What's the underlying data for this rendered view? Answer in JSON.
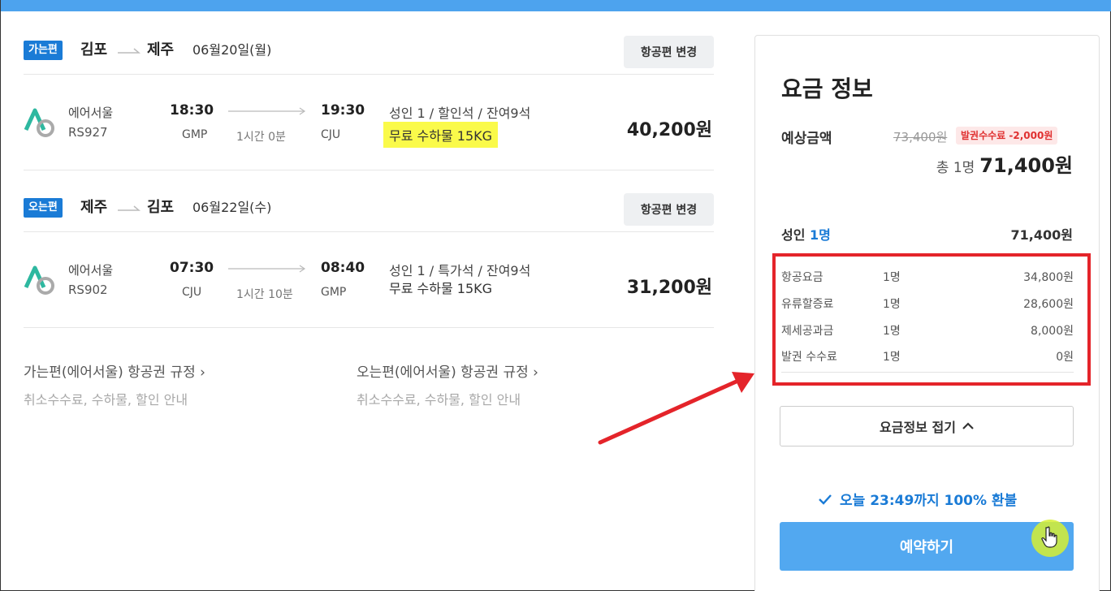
{
  "outbound": {
    "badge": "가는편",
    "from": "김포",
    "to": "제주",
    "date": "06월20일(월)",
    "change_label": "항공편 변경",
    "airline": "에어서울",
    "flight_no": "RS927",
    "dep_time": "18:30",
    "dep_airport": "GMP",
    "duration": "1시간 0분",
    "arr_time": "19:30",
    "arr_airport": "CJU",
    "fare": "성인 1 / 할인석 / 잔여9석",
    "baggage": "무료 수하물 15KG",
    "price": "40,200원"
  },
  "inbound": {
    "badge": "오는편",
    "from": "제주",
    "to": "김포",
    "date": "06월22일(수)",
    "change_label": "항공편 변경",
    "airline": "에어서울",
    "flight_no": "RS902",
    "dep_time": "07:30",
    "dep_airport": "CJU",
    "duration": "1시간 10분",
    "arr_time": "08:40",
    "arr_airport": "GMP",
    "fare": "성인 1 / 특가석 / 잔여9석",
    "baggage": "무료 수하물 15KG",
    "price": "31,200원"
  },
  "rules": [
    {
      "title": "가는편(에어서울) 항공권 규정 ›",
      "sub": "취소수수료, 수하물, 할인 안내"
    },
    {
      "title": "오는편(에어서울) 항공권 규정 ›",
      "sub": "취소수수료, 수하물, 할인 안내"
    }
  ],
  "summary": {
    "title": "요금 정보",
    "estimate_label": "예상금액",
    "original_price": "73,400원",
    "discount_badge": "발권수수료 -2,000원",
    "total_label": "총 1명",
    "total_amount": "71,400원",
    "adult_label": "성인",
    "adult_count": "1명",
    "adult_amount": "71,400원",
    "breakdown": [
      {
        "name": "항공요금",
        "count": "1명",
        "amount": "34,800원"
      },
      {
        "name": "유류할증료",
        "count": "1명",
        "amount": "28,600원"
      },
      {
        "name": "제세공과금",
        "count": "1명",
        "amount": "8,000원"
      },
      {
        "name": "발권 수수료",
        "count": "1명",
        "amount": "0원"
      }
    ],
    "fold_label": "요금정보 접기",
    "refund_text": "오늘 23:49까지 100% 환불",
    "book_label": "예약하기"
  },
  "colors": {
    "accent": "#1a7bd6",
    "highlight": "#fafa4a",
    "annotation_red": "#e4242a",
    "book_button": "#52a8f0"
  },
  "icons": [
    "air-seoul-logo",
    "route-arrow-icon",
    "chevron-right-icon",
    "chevron-up-icon",
    "check-icon",
    "hand-cursor-icon"
  ]
}
